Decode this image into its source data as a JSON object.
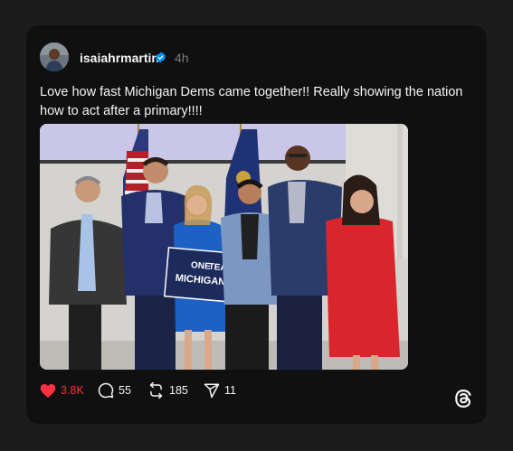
{
  "post": {
    "username": "isaiahrmartin",
    "time": "4h",
    "text": "Love how fast Michigan Dems came together!! Really showing the nation how to act after a primary!!!!",
    "sign_text": [
      "ONE",
      "TEAM",
      "MICHIGAN"
    ]
  },
  "actions": {
    "likes": "3.8K",
    "replies": "55",
    "reposts": "185",
    "shares": "11"
  },
  "colors": {
    "like": "#ff3040",
    "verified": "#0095f6",
    "background": "#1c1c1c",
    "card": "#101010"
  },
  "icons": [
    "heart-icon",
    "comment-icon",
    "repost-icon",
    "share-icon",
    "threads-logo-icon",
    "verified-badge-icon"
  ]
}
